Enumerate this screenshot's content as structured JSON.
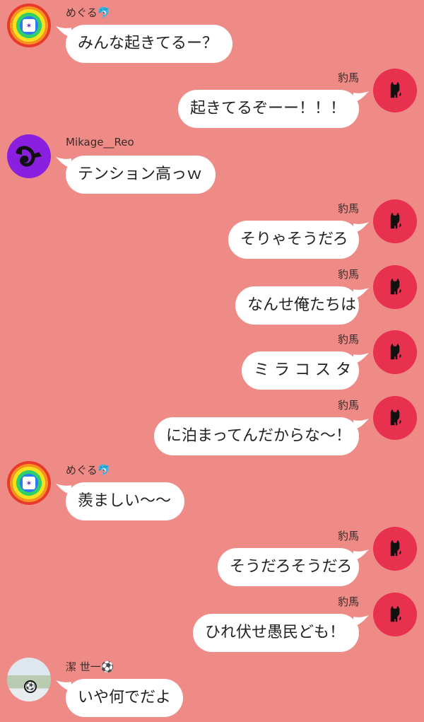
{
  "chat": {
    "messages": [
      {
        "side": "left",
        "avatar": "rainbow-burst-avatar",
        "name": "めぐる🐬",
        "text": "みんな起きてるー？"
      },
      {
        "side": "right",
        "avatar": "black-cat-avatar",
        "name": "豹馬",
        "text": "起きてるぞーー！！！"
      },
      {
        "side": "left",
        "avatar": "chameleon-avatar",
        "name": "Mikage__Reo",
        "text": "テンション高っｗ"
      },
      {
        "side": "right",
        "avatar": "black-cat-avatar",
        "name": "豹馬",
        "text": "そりゃそうだろ"
      },
      {
        "side": "right",
        "avatar": "black-cat-avatar",
        "name": "豹馬",
        "text": "なんせ俺たちは"
      },
      {
        "side": "right",
        "avatar": "black-cat-avatar",
        "name": "豹馬",
        "text": "ミ ラ コ ス タ"
      },
      {
        "side": "right",
        "avatar": "black-cat-avatar",
        "name": "豹馬",
        "text": "に泊まってんだからな〜！"
      },
      {
        "side": "left",
        "avatar": "rainbow-burst-avatar",
        "name": "めぐる🐬",
        "text": "羨ましい〜〜"
      },
      {
        "side": "right",
        "avatar": "black-cat-avatar",
        "name": "豹馬",
        "text": "そうだろそうだろ"
      },
      {
        "side": "right",
        "avatar": "black-cat-avatar",
        "name": "豹馬",
        "text": "ひれ伏せ愚民ども！"
      },
      {
        "side": "left",
        "avatar": "soccer-ball-avatar",
        "name": "潔 世一⚽",
        "text": "いや何でだよ"
      }
    ]
  },
  "colors": {
    "background": "#ef8b87",
    "bubble": "#ffffff",
    "right_avatar_bg": "#e8304f",
    "mikage_avatar_bg": "#8b1fe0"
  }
}
